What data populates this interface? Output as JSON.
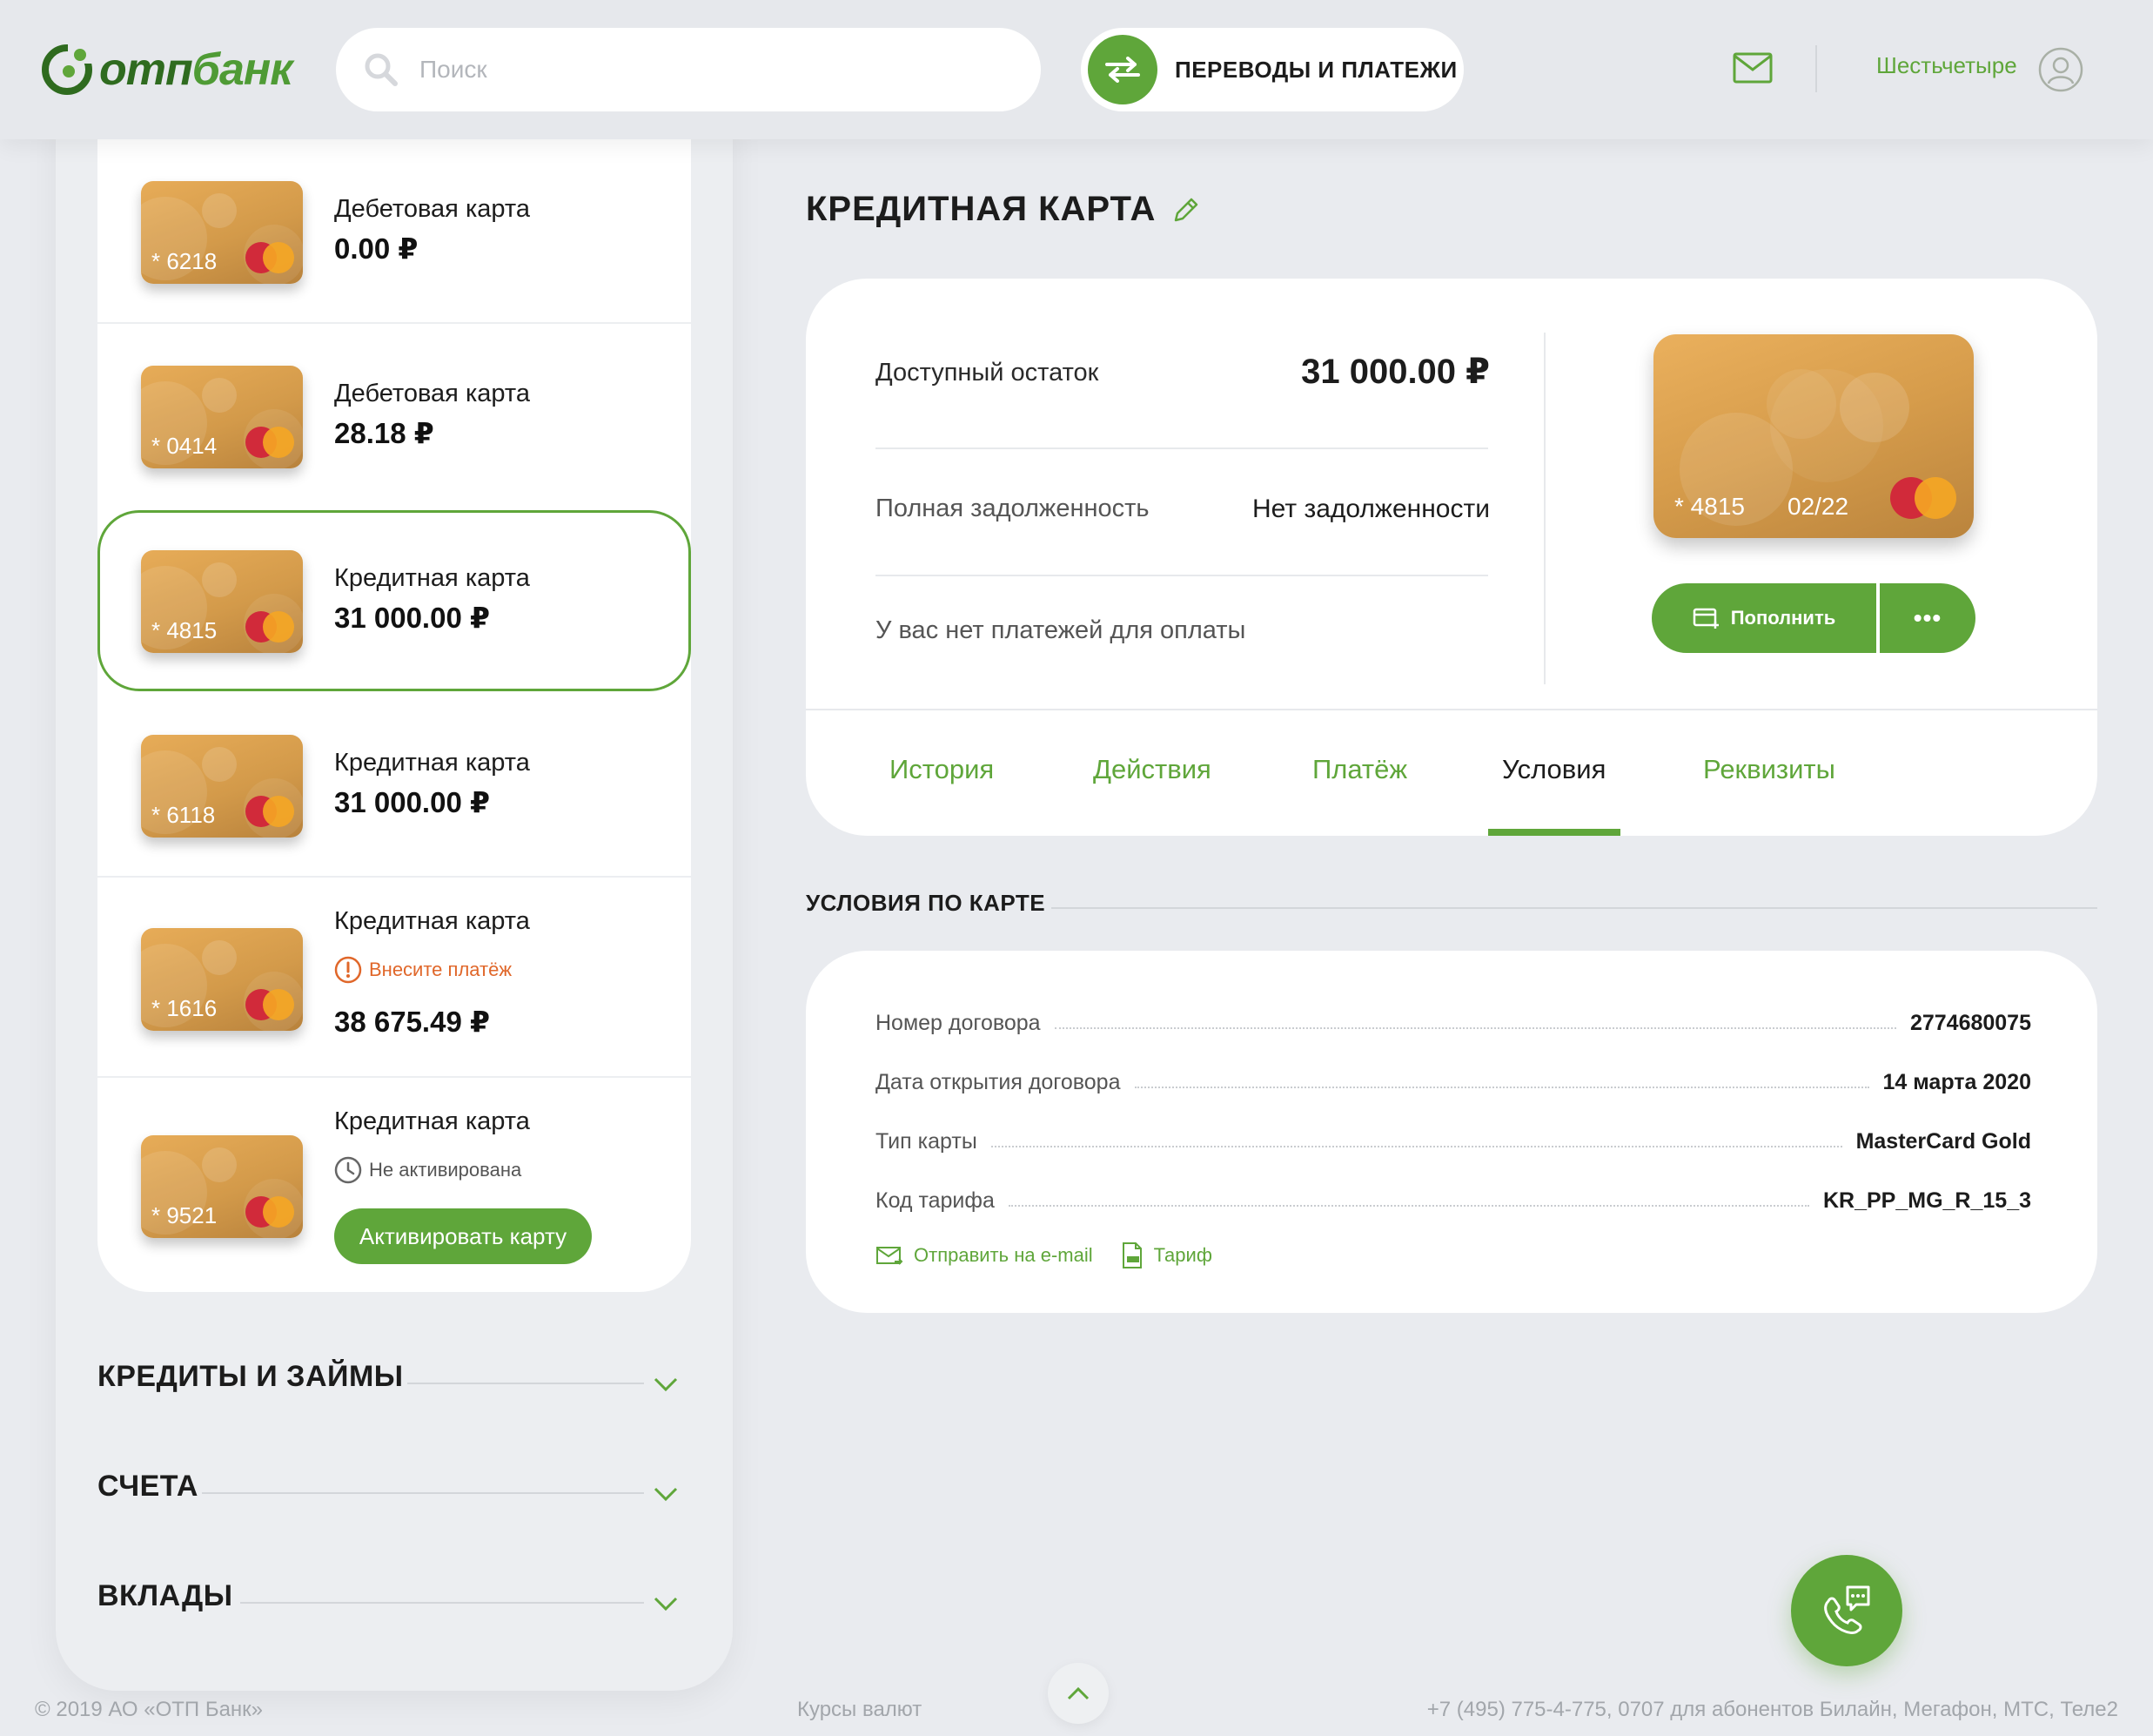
{
  "header": {
    "logo_text_a": "отп",
    "logo_text_b": "банк",
    "search_placeholder": "Поиск",
    "transfer_label": "ПЕРЕВОДЫ И ПЛАТЕЖИ",
    "user_name": "Шестьчетыре"
  },
  "sidebar": {
    "cards": [
      {
        "number": "* 6218",
        "title": "Дебетовая карта",
        "amount": "0.00 ₽"
      },
      {
        "number": "* 0414",
        "title": "Дебетовая карта",
        "amount": "28.18 ₽"
      },
      {
        "number": "* 4815",
        "title": "Кредитная карта",
        "amount": "31 000.00 ₽",
        "selected": true
      },
      {
        "number": "* 6118",
        "title": "Кредитная карта",
        "amount": "31 000.00 ₽"
      },
      {
        "number": "* 1616",
        "title": "Кредитная карта",
        "warning": "Внесите платёж",
        "amount": "38 675.49 ₽"
      },
      {
        "number": "* 9521",
        "title": "Кредитная карта",
        "status": "Не активирована",
        "action": "Активировать карту"
      }
    ],
    "sections": [
      "КРЕДИТЫ И ЗАЙМЫ",
      "СЧЕТА",
      "ВКЛАДЫ"
    ]
  },
  "main": {
    "title": "КРЕДИТНАЯ КАРТА",
    "available_label": "Доступный остаток",
    "available_value": "31 000.00 ₽",
    "debt_label": "Полная задолженность",
    "debt_value": "Нет задолженности",
    "no_payments": "У вас нет платежей для оплаты",
    "card_number": "* 4815",
    "card_expiry": "02/22",
    "topup_label": "Пополнить",
    "more_label": "•••",
    "tabs": [
      "История",
      "Действия",
      "Платёж",
      "Условия",
      "Реквизиты"
    ],
    "active_tab": "Условия"
  },
  "terms": {
    "heading": "УСЛОВИЯ ПО КАРТЕ",
    "rows": [
      {
        "label": "Номер договора",
        "value": "2774680075"
      },
      {
        "label": "Дата открытия договора",
        "value": "14 марта 2020"
      },
      {
        "label": "Тип карты",
        "value": "MasterCard Gold"
      },
      {
        "label": "Код тарифа",
        "value": "KR_PP_MG_R_15_3"
      }
    ],
    "email_link": "Отправить на e-mail",
    "tariff_link": "Тариф"
  },
  "footer": {
    "copyright": "© 2019 АО «ОТП Банк»",
    "rates": "Курсы валют",
    "phones": "+7 (495) 775-4-775,  0707 для абонентов Билайн, Мегафон, МТС, Теле2"
  },
  "colors": {
    "accent": "#5fa63a",
    "warning": "#e0672a",
    "background": "#e9ebef"
  },
  "icons": [
    "search-icon",
    "transfer-icon",
    "mail-icon",
    "user-avatar-icon",
    "edit-pencil-icon",
    "warning-icon",
    "clock-icon",
    "chevron-down-icon",
    "topup-card-icon",
    "email-icon",
    "pdf-icon",
    "phone-chat-icon",
    "chevron-up-icon"
  ]
}
